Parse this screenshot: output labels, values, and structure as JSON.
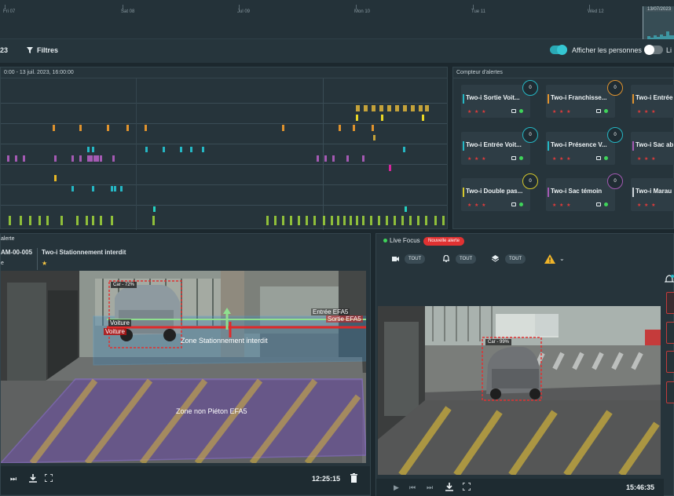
{
  "timeline": {
    "days": [
      "Fri 07",
      "Sat 08",
      "Jul 09",
      "Mon 10",
      "Tue 11",
      "Wed 12"
    ],
    "selection_label": "13/07/2023"
  },
  "filterbar": {
    "left_text": "23",
    "filters_label": "Filtres",
    "show_persons_label": "Afficher les personnes",
    "second_toggle_label": "Li"
  },
  "activity": {
    "range_label": "0:00  -  13 juil. 2023, 16:00:00"
  },
  "counter": {
    "title": "Compteur d'alertes",
    "cards": [
      {
        "name": "Two-i Sortie Voit...",
        "count": "0",
        "color": "#25b7c4"
      },
      {
        "name": "Two-i Franchisse...",
        "count": "0",
        "color": "#e0932e"
      },
      {
        "name": "Two-i Entrée",
        "count": "",
        "color": "#e0932e"
      },
      {
        "name": "Two-i Entrée Voit...",
        "count": "0",
        "color": "#25b7c4"
      },
      {
        "name": "Two-i Présence V...",
        "count": "0",
        "color": "#25b7c4"
      },
      {
        "name": "Two-i Sac ab",
        "count": "",
        "color": "#a45ab3"
      },
      {
        "name": "Two-i Double pas...",
        "count": "0",
        "color": "#d6c82c"
      },
      {
        "name": "Two-i Sac témoin",
        "count": "0",
        "color": "#a45ab3"
      },
      {
        "name": "Two-i Marau",
        "count": "",
        "color": "#d0d7db"
      }
    ]
  },
  "alert": {
    "header_label": "alerte",
    "camera_id": "AM-00-005",
    "alert_name": "Two-i Stationnement interdit",
    "row3_left": "e",
    "detection_label": "Car - 72%",
    "voiture_1": "Voiture",
    "voiture_2": "Voiture",
    "entree_label": "Entrée EFA5",
    "sortie_label": "Sortie EFA5",
    "zone1": "Zone Stationnement interdit",
    "zone2": "Zone non Piéton EFA5",
    "timestamp": "12:25:15"
  },
  "live": {
    "title": "Live Focus",
    "new_alert": "Nouvelle alerte",
    "filter_values": [
      "TOUT",
      "TOUT",
      "TOUT"
    ],
    "detection_label": "Car - 99%",
    "timestamp": "15:46:35"
  },
  "colors": {
    "accent": "#29b9c7",
    "alert_red": "#e03232",
    "star": "#f5c542"
  }
}
